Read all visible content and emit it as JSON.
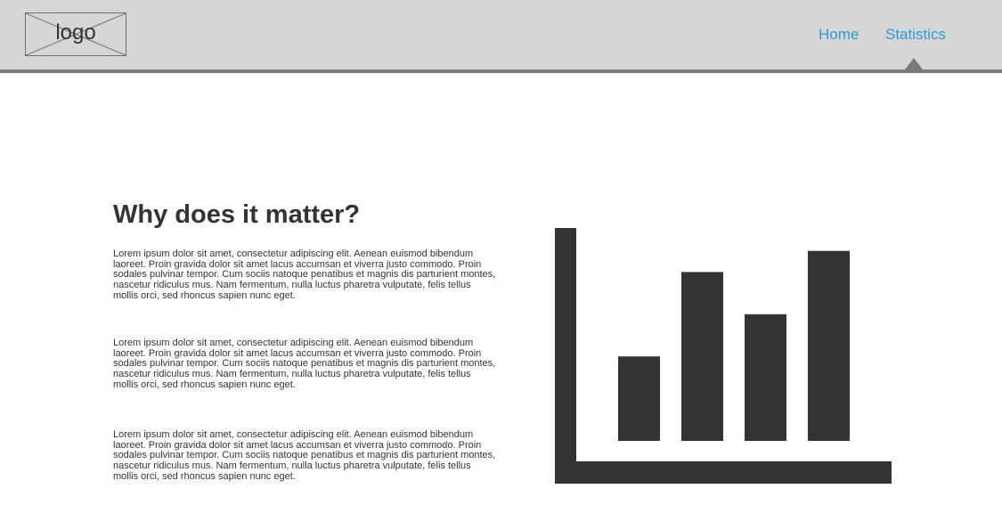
{
  "header": {
    "logo_text": "logo",
    "nav": [
      {
        "label": "Home"
      },
      {
        "label": "Statistics"
      }
    ],
    "active_nav": "Statistics"
  },
  "main": {
    "heading": "Why does it matter?",
    "paragraphs": [
      "Lorem ipsum dolor sit amet, consectetur adipiscing elit. Aenean euismod bibendum laoreet. Proin gravida dolor sit amet lacus accumsan et viverra justo commodo. Proin sodales pulvinar tempor. Cum sociis natoque penatibus et magnis dis parturient montes, nascetur ridiculus mus. Nam fermentum, nulla luctus pharetra vulputate, felis tellus mollis orci, sed rhoncus sapien nunc eget.",
      "Lorem ipsum dolor sit amet, consectetur adipiscing elit. Aenean euismod bibendum laoreet. Proin gravida dolor sit amet lacus accumsan et viverra justo commodo. Proin sodales pulvinar tempor. Cum sociis natoque penatibus et magnis dis parturient montes, nascetur ridiculus mus. Nam fermentum, nulla luctus pharetra vulputate, felis tellus mollis orci, sed rhoncus sapien nunc eget.",
      "Lorem ipsum dolor sit amet, consectetur adipiscing elit. Aenean euismod bibendum laoreet. Proin gravida dolor sit amet lacus accumsan et viverra justo commodo. Proin sodales pulvinar tempor. Cum sociis natoque penatibus et magnis dis parturient montes, nascetur ridiculus mus. Nam fermentum, nulla luctus pharetra vulputate, felis tellus mollis orci, sed rhoncus sapien nunc eget."
    ]
  },
  "colors": {
    "header_bg": "#d6d6d6",
    "header_border": "#7a7a7a",
    "link": "#2b9ad6",
    "chart_fill": "#333333"
  },
  "icons": {
    "logo_placeholder": "image-placeholder-icon",
    "chart": "bar-chart-icon"
  },
  "chart_data": {
    "type": "bar",
    "categories": [
      "",
      "",
      "",
      ""
    ],
    "values": [
      40,
      80,
      60,
      90
    ],
    "ylim": [
      0,
      100
    ],
    "grid": false
  }
}
